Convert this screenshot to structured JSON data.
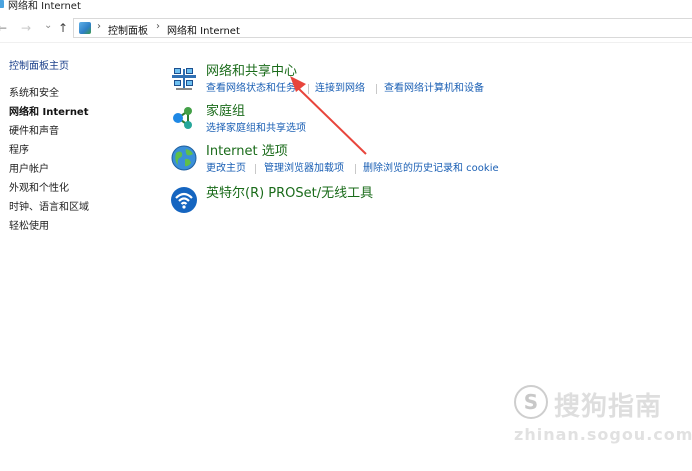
{
  "window": {
    "title": "网络和 Internet"
  },
  "address_bar": {
    "back_label": "←",
    "forward_label": "→",
    "recent_label": "⌄",
    "up_label": "↑",
    "separator": "›",
    "breadcrumb": [
      "控制面板",
      "网络和 Internet"
    ]
  },
  "sidebar": {
    "home": "控制面板主页",
    "items": [
      {
        "label": "系统和安全",
        "current": false
      },
      {
        "label": "网络和 Internet",
        "current": true
      },
      {
        "label": "硬件和声音",
        "current": false
      },
      {
        "label": "程序",
        "current": false
      },
      {
        "label": "用户帐户",
        "current": false
      },
      {
        "label": "外观和个性化",
        "current": false
      },
      {
        "label": "时钟、语言和区域",
        "current": false
      },
      {
        "label": "轻松使用",
        "current": false
      }
    ]
  },
  "categories": [
    {
      "title": "网络和共享中心",
      "icon": "network-sharing-center-icon",
      "links": [
        "查看网络状态和任务",
        "连接到网络",
        "查看网络计算机和设备"
      ]
    },
    {
      "title": "家庭组",
      "icon": "homegroup-icon",
      "links": [
        "选择家庭组和共享选项"
      ]
    },
    {
      "title": "Internet 选项",
      "icon": "internet-options-globe-icon",
      "links": [
        "更改主页",
        "管理浏览器加载项",
        "删除浏览的历史记录和 cookie"
      ]
    },
    {
      "title": "英特尔(R) PROSet/无线工具",
      "icon": "wireless-signal-icon",
      "links": []
    }
  ],
  "annotation": {
    "color": "#e8453c"
  },
  "watermark": {
    "logo_letter": "S",
    "name": "搜狗指南",
    "url": "zhinan.sogou.com"
  },
  "colors": {
    "category_title": "#1a6b1a",
    "link": "#1a5fb4",
    "background": "#ffffff"
  }
}
